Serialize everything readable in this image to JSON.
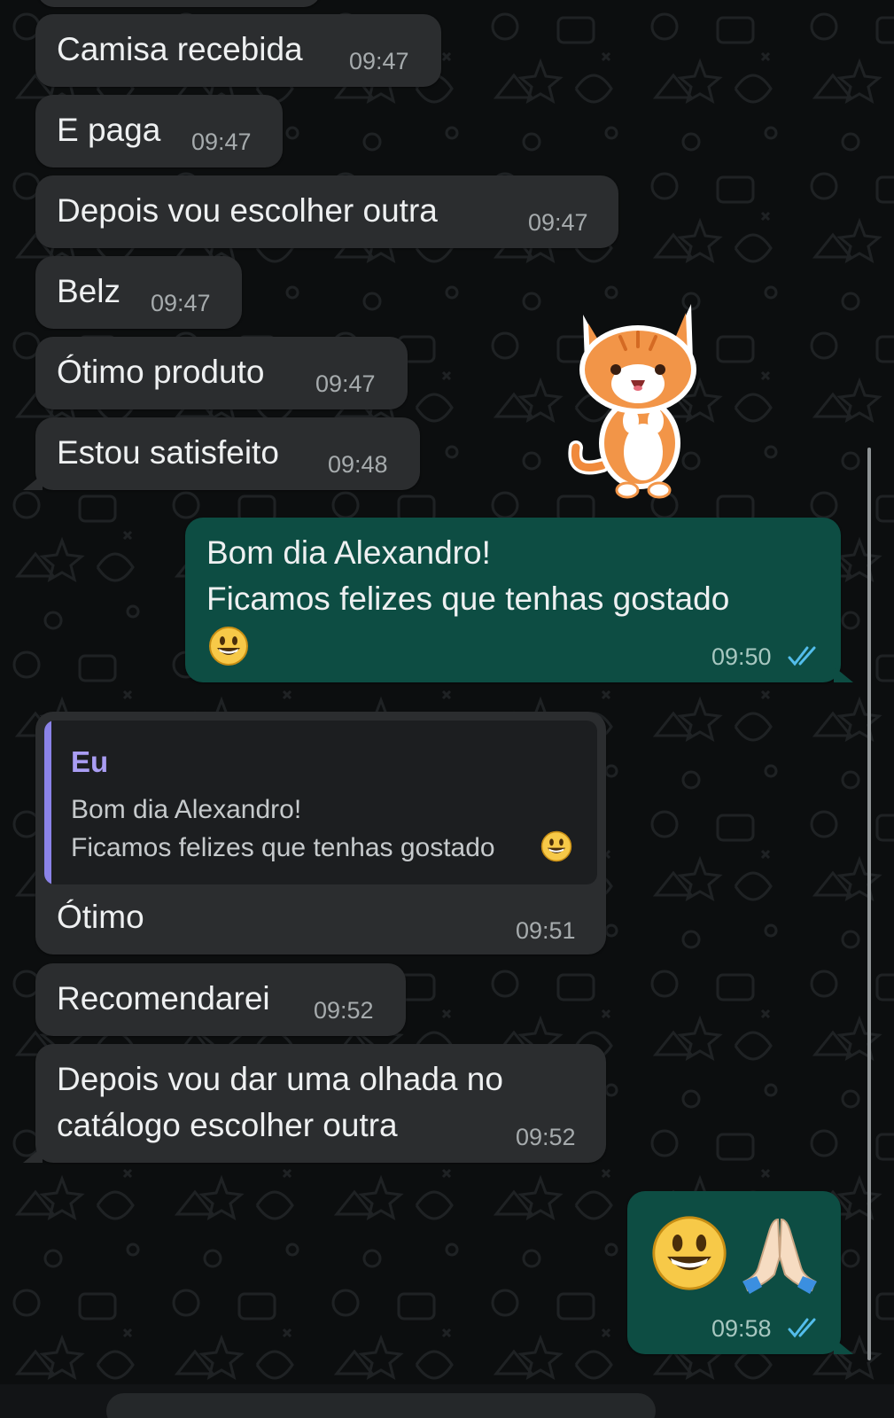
{
  "theme": {
    "incoming_bubble": "#2b2d2f",
    "outgoing_bubble": "#0d4d43",
    "read_ticks": "#53bdeb",
    "quote_accent": "#8b83e8"
  },
  "messages": [
    {
      "id": "m1",
      "direction": "in",
      "text": "Camisa recebida",
      "time": "09:47"
    },
    {
      "id": "m2",
      "direction": "in",
      "text": "E paga",
      "time": "09:47"
    },
    {
      "id": "m3",
      "direction": "in",
      "text": "Depois vou escolher outra",
      "time": "09:47"
    },
    {
      "id": "m4",
      "direction": "in",
      "text": "Belz",
      "time": "09:47"
    },
    {
      "id": "m5",
      "direction": "in",
      "text": "Ótimo produto",
      "time": "09:47"
    },
    {
      "id": "m6",
      "direction": "in",
      "text": "Estou satisfeito",
      "time": "09:48"
    },
    {
      "id": "m7",
      "direction": "out",
      "line1": "Bom dia Alexandro!",
      "line2": "Ficamos felizes que tenhas gostado",
      "emoji": "smiley-emoji",
      "time": "09:50",
      "status": "read"
    },
    {
      "id": "m8",
      "direction": "in",
      "quote": {
        "author": "Eu",
        "line1": "Bom dia Alexandro!",
        "line2": "Ficamos felizes que tenhas gostado"
      },
      "text": "Ótimo",
      "time": "09:51"
    },
    {
      "id": "m9",
      "direction": "in",
      "text": "Recomendarei",
      "time": "09:52"
    },
    {
      "id": "m10",
      "direction": "in",
      "line1": "Depois vou dar uma olhada no",
      "line2": "catálogo escolher outra",
      "time": "09:52"
    },
    {
      "id": "m11",
      "direction": "out",
      "emojis": [
        "smiley-emoji",
        "folded-hands-emoji"
      ],
      "time": "09:58",
      "status": "read"
    }
  ],
  "sticker": {
    "name": "orange-cat-sticker"
  }
}
